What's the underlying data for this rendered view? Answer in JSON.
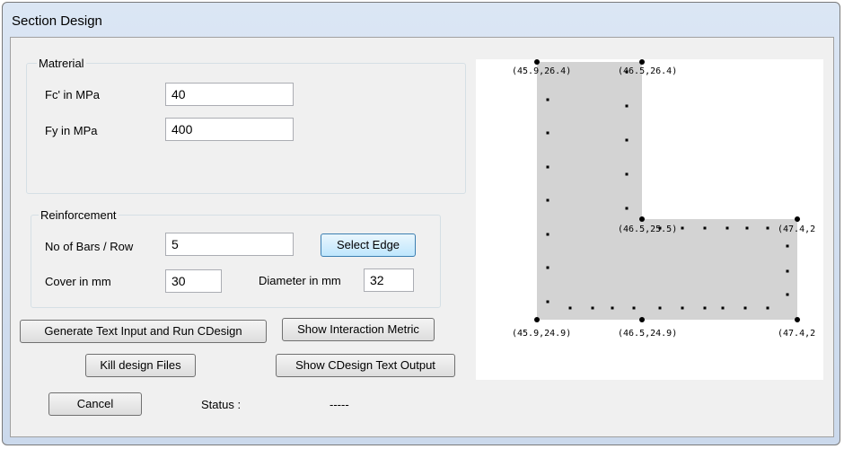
{
  "window": {
    "title": "Section Design"
  },
  "material": {
    "legend": "Matrerial",
    "fc_label": "Fc' in MPa",
    "fc_value": "40",
    "fy_label": "Fy in MPa",
    "fy_value": "400"
  },
  "reinforcement": {
    "legend": "Reinforcement",
    "bars_label": "No of Bars / Row",
    "bars_value": "5",
    "select_edge_label": "Select Edge",
    "cover_label": "Cover in mm",
    "cover_value": "30",
    "diameter_label": "Diameter in mm",
    "diameter_value": "32"
  },
  "buttons": {
    "generate": "Generate Text Input and Run CDesign",
    "show_interaction": "Show Interaction Metric",
    "kill_files": "Kill design Files",
    "show_output": "Show CDesign Text Output",
    "cancel": "Cancel"
  },
  "status": {
    "label": "Status :",
    "value": "-----"
  },
  "section_view": {
    "fill_color": "#d3d3d3",
    "vertex_labels": {
      "top_left": "(45.9,26.4)",
      "top_right": "(46.5,26.4)",
      "inner_corner": "(46.5,25.5)",
      "right_top": "(47.4,2",
      "bottom_left": "(45.9,24.9)",
      "bottom_mid": "(46.5,24.9)",
      "bottom_right": "(47.4,2"
    }
  }
}
